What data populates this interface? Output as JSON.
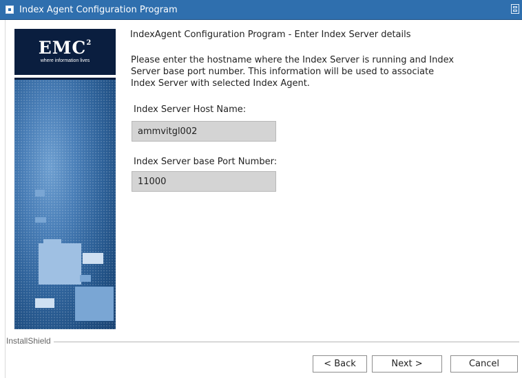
{
  "window": {
    "title": "Index Agent Configuration Program"
  },
  "banner": {
    "logo": "EMC",
    "logo_sup": "2",
    "tagline": "where information lives"
  },
  "content": {
    "heading": "IndexAgent Configuration Program - Enter Index Server details",
    "description": "Please enter the hostname where the Index Server is running and Index Server base port number. This information will be used to associate Index Server with selected Index Agent.",
    "host_label": "Index Server Host Name:",
    "host_value": "ammvitgl002",
    "port_label": "Index Server base Port Number:",
    "port_value": "11000"
  },
  "footer": {
    "installshield_label": "InstallShield",
    "back_label": "< Back",
    "next_label": "Next >",
    "cancel_label": "Cancel"
  },
  "colors": {
    "titlebar": "#2f6fae",
    "banner_dark": "#0a1e3f",
    "field_bg": "#d4d4d4"
  }
}
